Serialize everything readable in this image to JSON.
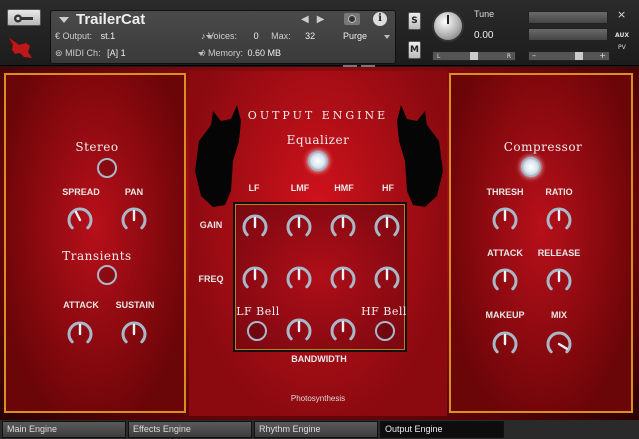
{
  "header": {
    "instrument_name": "TrailerCat",
    "output_label": "Output:",
    "output_value": "st.1",
    "voices_label": "Voices:",
    "voices_value": "0",
    "max_label": "Max:",
    "max_value": "32",
    "purge_label": "Purge",
    "midi_label": "MIDI Ch:",
    "midi_value": "[A] 1",
    "memory_label": "Memory:",
    "memory_value": "0.60 MB",
    "solo_label": "S",
    "mute_label": "M",
    "tune_label": "Tune",
    "tune_value": "0.00",
    "pan_left": "L",
    "pan_right": "R",
    "aux_label": "AUX",
    "pv_label": "PV",
    "close_label": "×"
  },
  "left_panel": {
    "stereo_title": "Stereo",
    "spread_label": "SPREAD",
    "pan_label": "PAN",
    "transients_title": "Transients",
    "attack_label": "ATTACK",
    "sustain_label": "SUSTAIN"
  },
  "center_panel": {
    "title": "OUTPUT ENGINE",
    "equalizer_title": "Equalizer",
    "band_labels": [
      "LF",
      "LMF",
      "HMF",
      "HF"
    ],
    "gain_label": "GAIN",
    "freq_label": "FREQ",
    "lf_bell_label": "LF Bell",
    "hf_bell_label": "HF Bell",
    "bandwidth_label": "BANDWIDTH",
    "footer": "Photosynthesis"
  },
  "right_panel": {
    "compressor_title": "Compressor",
    "thresh_label": "THRESH",
    "ratio_label": "RATIO",
    "attack_label": "ATTACK",
    "release_label": "RELEASE",
    "makeup_label": "MAKEUP",
    "mix_label": "MIX"
  },
  "tabs": [
    {
      "label": "Main Engine",
      "active": false
    },
    {
      "label": "Effects Engine",
      "active": false
    },
    {
      "label": "Rhythm Engine",
      "active": false
    },
    {
      "label": "Output Engine",
      "active": true
    }
  ],
  "colors": {
    "accent_border": "#d89020",
    "knob_ring": "#a8b8c8",
    "background_red": "#c8141c"
  }
}
